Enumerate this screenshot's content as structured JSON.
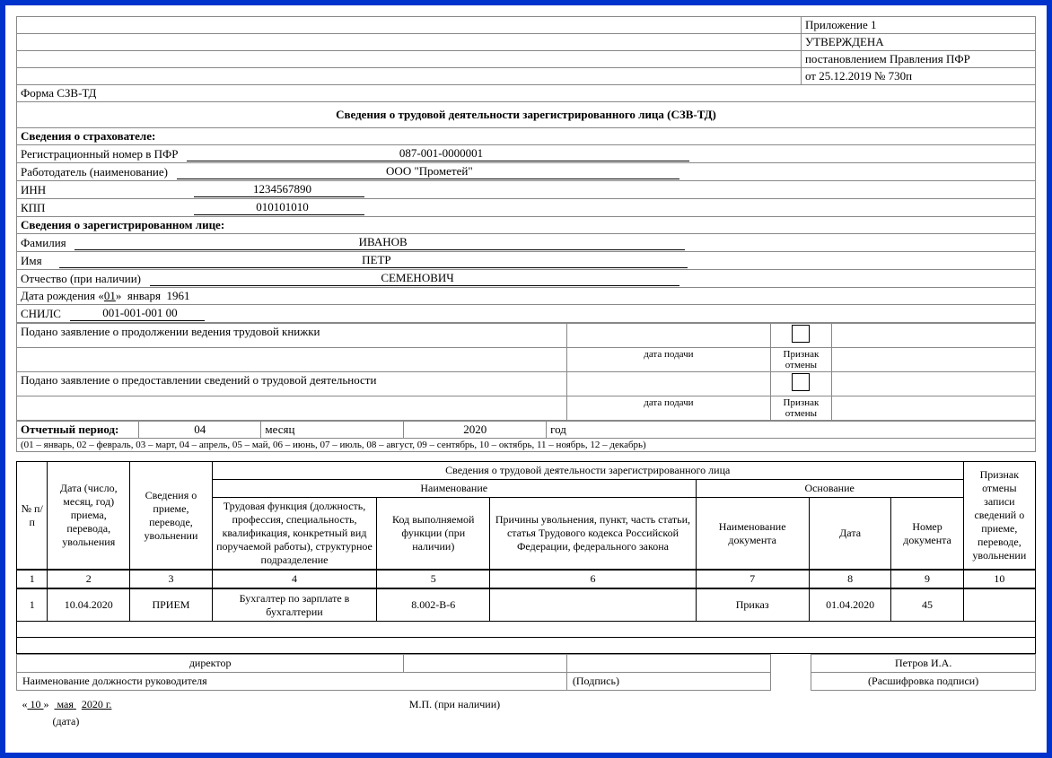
{
  "header": {
    "appendix": "Приложение 1",
    "approved": "УТВЕРЖДЕНА",
    "decree": "постановлением Правления ПФР",
    "date_no": "от 25.12.2019   № 730п",
    "form_code": "Форма СЗВ-ТД",
    "title": "Сведения о трудовой деятельности зарегистрированного лица (СЗВ-ТД)"
  },
  "insurer": {
    "section": "Сведения о страхователе:",
    "reg_label": "Регистрационный номер в ПФР",
    "reg_value": "087-001-0000001",
    "employer_label": "Работодатель (наименование)",
    "employer_value": "ООО \"Прометей\"",
    "inn_label": "ИНН",
    "inn_value": "1234567890",
    "kpp_label": "КПП",
    "kpp_value": "010101010"
  },
  "person": {
    "section": "Сведения о зарегистрированном лице:",
    "lastname_label": "Фамилия",
    "lastname": "ИВАНОВ",
    "firstname_label": "Имя",
    "firstname": "ПЕТР",
    "patronymic_label": "Отчество (при наличии)",
    "patronymic": "СЕМЕНОВИЧ",
    "dob_label": "Дата рождения «",
    "dob_day": "01",
    "dob_mid": "»",
    "dob_month": "января",
    "dob_year": "1961",
    "snils_label": "СНИЛС",
    "snils": "001-001-001 00"
  },
  "statements": {
    "continue": "Подано заявление о продолжении ведения трудовой книжки",
    "provide": "Подано заявление о предоставлении сведений о трудовой деятельности",
    "date_label": "дата подачи",
    "cancel_label": "Признак отмены"
  },
  "period": {
    "label": "Отчетный период:",
    "month_val": "04",
    "month_label": "месяц",
    "year_val": "2020",
    "year_label": "год",
    "note": "(01 – январь, 02 – февраль, 03 – март, 04 – апрель, 05 – май, 06 – июнь, 07 – июль, 08 – август, 09 – сентябрь, 10 – октябрь, 11 – ноябрь, 12 – декабрь)"
  },
  "table": {
    "caption": "Сведения о трудовой деятельности зарегистрированного лица",
    "h_num": "№ п/п",
    "h_date": "Дата (число, месяц, год) приема, перевода, увольнения",
    "h_event": "Сведения о приеме, переводе, увольнении",
    "h_name_group": "Наименование",
    "h_func": "Трудовая функция (должность, профессия, специальность, квалификация, конкретный вид поручаемой работы), структурное подразделение",
    "h_code": "Код выполняемой функции (при наличии)",
    "h_reason": "Причины увольнения, пункт, часть статьи, статья Трудового кодекса Российской Федерации, федерального закона",
    "h_basis_group": "Основание",
    "h_docname": "Наименование документа",
    "h_docdate": "Дата",
    "h_docnum": "Номер документа",
    "h_cancel": "Признак отмены записи сведений о приеме, переводе, увольнении",
    "cols": {
      "c1": "1",
      "c2": "2",
      "c3": "3",
      "c4": "4",
      "c5": "5",
      "c6": "6",
      "c7": "7",
      "c8": "8",
      "c9": "9",
      "c10": "10"
    },
    "row": {
      "n": "1",
      "date": "10.04.2020",
      "event": "ПРИЕМ",
      "func": "Бухгалтер по зарплате в бухгалтерии",
      "code": "8.002-В-6",
      "reason": "",
      "docname": "Приказ",
      "docdate": "01.04.2020",
      "docnum": "45",
      "cancel": ""
    }
  },
  "sign": {
    "position": "директор",
    "position_label": "Наименование должности руководителя",
    "signature_label": "(Подпись)",
    "name": "Петров И.А.",
    "name_label": "(Расшифровка подписи)",
    "date_prefix": "«",
    "date_day": "10",
    "date_mid": "»",
    "date_month": "мая",
    "date_year": "2020 г.",
    "date_label": "(дата)",
    "stamp": "М.П. (при наличии)"
  }
}
